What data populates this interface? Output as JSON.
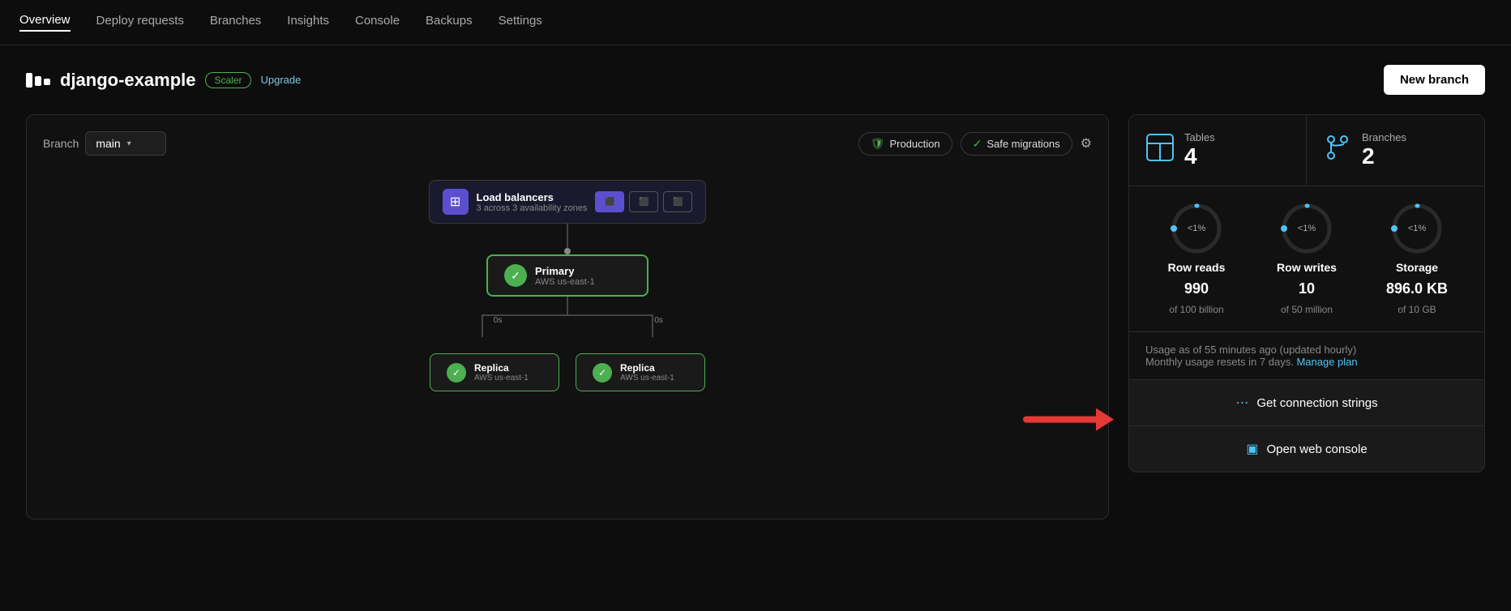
{
  "nav": {
    "items": [
      {
        "label": "Overview",
        "active": true
      },
      {
        "label": "Deploy requests",
        "active": false
      },
      {
        "label": "Branches",
        "active": false
      },
      {
        "label": "Insights",
        "active": false
      },
      {
        "label": "Console",
        "active": false
      },
      {
        "label": "Backups",
        "active": false
      },
      {
        "label": "Settings",
        "active": false
      }
    ]
  },
  "header": {
    "logo_label": "django-example",
    "badge_label": "Scaler",
    "upgrade_label": "Upgrade",
    "new_branch_label": "New branch"
  },
  "branch_bar": {
    "branch_label": "Branch",
    "branch_value": "main",
    "production_label": "Production",
    "safe_migrations_label": "Safe migrations"
  },
  "diagram": {
    "lb_title": "Load balancers",
    "lb_subtitle": "3 across 3 availability zones",
    "primary_title": "Primary",
    "primary_region": "AWS us-east-1",
    "replica1_title": "Replica",
    "replica1_region": "AWS us-east-1",
    "replica2_title": "Replica",
    "replica2_region": "AWS us-east-1",
    "latency_left": "0s",
    "latency_right": "0s"
  },
  "stats": {
    "tables_label": "Tables",
    "tables_value": "4",
    "branches_label": "Branches",
    "branches_value": "2"
  },
  "usage": {
    "row_reads_label": "Row reads",
    "row_reads_value": "990",
    "row_reads_of": "of 100 billion",
    "row_reads_pct": "<1%",
    "row_writes_label": "Row writes",
    "row_writes_value": "10",
    "row_writes_of": "of 50 million",
    "row_writes_pct": "<1%",
    "storage_label": "Storage",
    "storage_value": "896.0 KB",
    "storage_of": "of 10 GB",
    "storage_pct": "<1%",
    "updated_text": "Usage as of 55 minutes ago",
    "updated_suffix": " (updated hourly)",
    "reset_text": "Monthly usage resets in 7 days.",
    "manage_plan_label": "Manage plan"
  },
  "actions": {
    "connection_strings_label": "Get connection strings",
    "web_console_label": "Open web console"
  }
}
